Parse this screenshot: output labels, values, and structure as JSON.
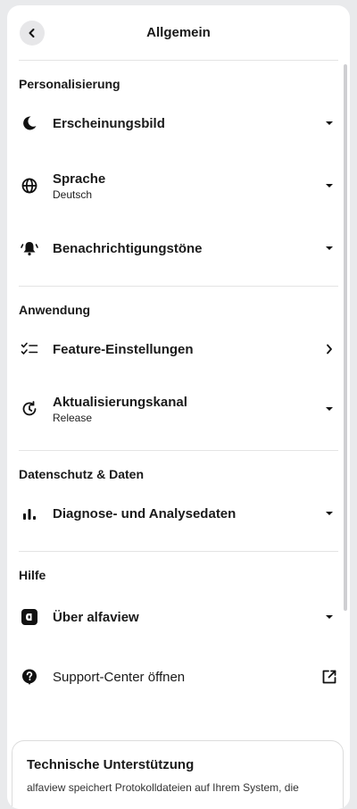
{
  "header": {
    "title": "Allgemein"
  },
  "sections": {
    "personalisierung": {
      "title": "Personalisierung",
      "appearance": "Erscheinungsbild",
      "language": "Sprache",
      "language_value": "Deutsch",
      "sounds": "Benachrichtigungstöne"
    },
    "anwendung": {
      "title": "Anwendung",
      "features": "Feature-Einstellungen",
      "channel": "Aktualisierungskanal",
      "channel_value": "Release"
    },
    "datenschutz": {
      "title": "Datenschutz & Daten",
      "diagnostics": "Diagnose- und Analysedaten"
    },
    "hilfe": {
      "title": "Hilfe",
      "about": "Über alfaview",
      "support": "Support-Center öffnen"
    }
  },
  "card": {
    "title": "Technische Unterstützung",
    "text": "alfaview speichert Protokolldateien auf Ihrem System, die"
  },
  "icons": {
    "back": "chevron-left-icon",
    "appearance": "moon-icon",
    "language": "globe-icon",
    "sounds": "bell-ring-icon",
    "features": "checklist-icon",
    "channel": "update-icon",
    "diagnostics": "bar-chart-icon",
    "about": "alfaview-logo-icon",
    "support": "question-circle-icon",
    "external": "external-link-icon"
  }
}
